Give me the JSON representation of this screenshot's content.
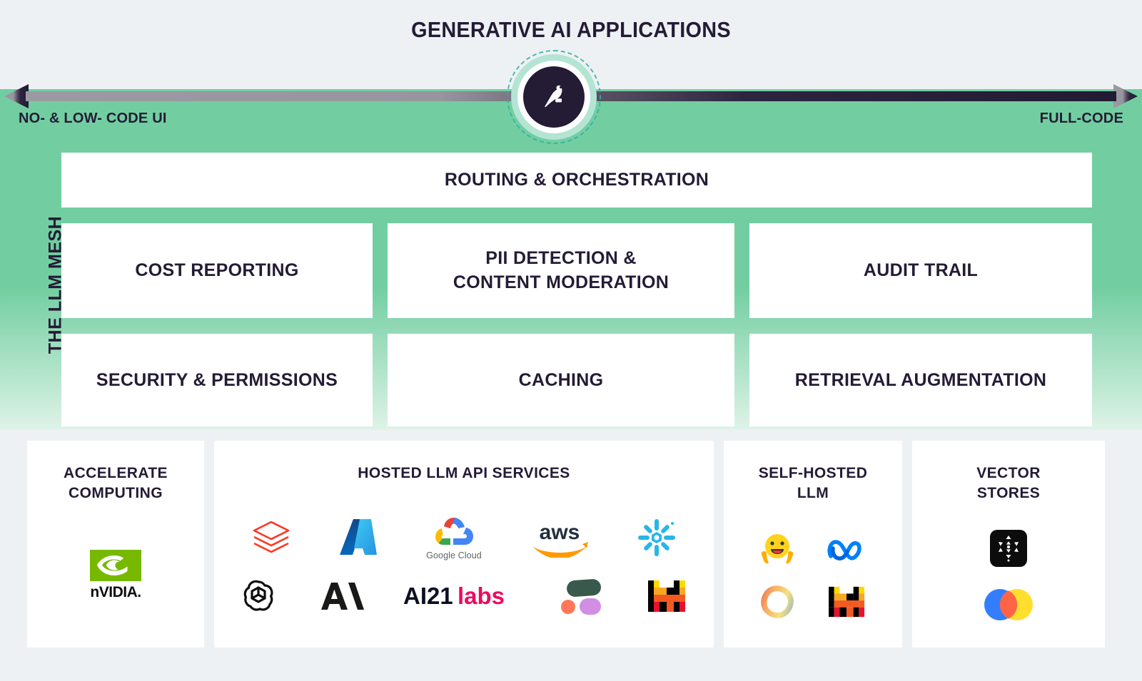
{
  "header": {
    "title": "GENERATIVE AI APPLICATIONS"
  },
  "axis": {
    "left_label": "NO- & LOW- CODE UI",
    "right_label": "FULL-CODE",
    "left_color": "#98989f",
    "right_color": "#231a33"
  },
  "brand": {
    "logo_name": "dataiku-bird-logo",
    "disc_color": "#241b35",
    "halo_color": "#b4e4d3",
    "dash_color": "#31b0a4"
  },
  "mesh": {
    "side_label": "THE LLM MESH",
    "panel_color": "#72cea1",
    "rows": [
      {
        "boxes": [
          {
            "label": "ROUTING & ORCHESTRATION"
          }
        ]
      },
      {
        "boxes": [
          {
            "label": "COST REPORTING"
          },
          {
            "label": "PII DETECTION &\nCONTENT MODERATION"
          },
          {
            "label": "AUDIT TRAIL"
          }
        ]
      },
      {
        "boxes": [
          {
            "label": "SECURITY & PERMISSIONS"
          },
          {
            "label": "CACHING"
          },
          {
            "label": "RETRIEVAL AUGMENTATION"
          }
        ]
      }
    ]
  },
  "infrastructure": {
    "background_color": "#eef1f4",
    "cards": [
      {
        "title": "ACCELERATE\nCOMPUTING",
        "logos": [
          {
            "name": "nvidia-logo",
            "label": "nVIDIA."
          }
        ]
      },
      {
        "title": "HOSTED LLM API SERVICES",
        "logos": [
          {
            "name": "databricks-logo",
            "label": "Databricks"
          },
          {
            "name": "microsoft-azure-logo",
            "label": "Azure"
          },
          {
            "name": "google-cloud-logo",
            "label": "Google Cloud"
          },
          {
            "name": "aws-logo",
            "label": "aws"
          },
          {
            "name": "snowflake-logo",
            "label": "Snowflake"
          },
          {
            "name": "openai-logo",
            "label": "OpenAI"
          },
          {
            "name": "anthropic-logo",
            "label": "Anthropic"
          },
          {
            "name": "ai21-labs-logo",
            "label": "AI21 labs"
          },
          {
            "name": "cohere-logo",
            "label": "Cohere"
          },
          {
            "name": "mistral-ai-logo",
            "label": "Mistral AI"
          }
        ]
      },
      {
        "title": "SELF-HOSTED\nLLM",
        "logos": [
          {
            "name": "hugging-face-logo",
            "label": "Hugging Face"
          },
          {
            "name": "meta-logo",
            "label": "Meta"
          },
          {
            "name": "falcon-llm-logo",
            "label": "Falcon"
          },
          {
            "name": "mistral-ai-logo",
            "label": "Mistral AI"
          }
        ]
      },
      {
        "title": "VECTOR\nSTORES",
        "logos": [
          {
            "name": "pinecone-logo",
            "label": "Pinecone"
          },
          {
            "name": "chroma-logo",
            "label": "Chroma"
          }
        ]
      }
    ]
  },
  "labels": {
    "google_cloud_wordmark": "Google Cloud",
    "ai21_prefix": "AI21",
    "ai21_suffix": "labs",
    "aws_wordmark": "aws"
  }
}
